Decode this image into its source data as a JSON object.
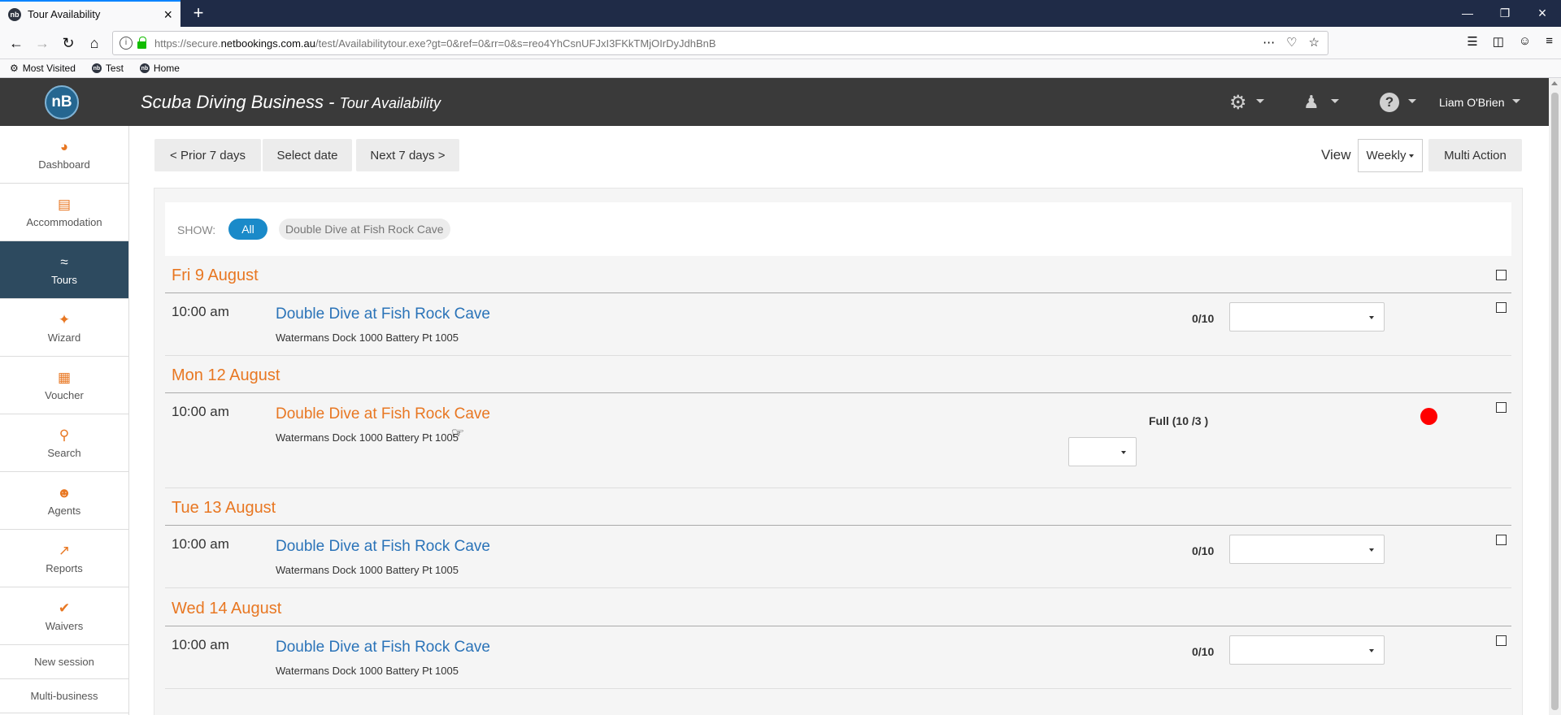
{
  "browser": {
    "tab_title": "Tour Availability",
    "tab_favicon": "nb",
    "url_prefix": "https://secure.",
    "url_host": "netbookings.com.au",
    "url_path": "/test/Availabilitytour.exe?gt=0&ref=0&rr=0&s=reo4YhCsnUFJxI3FKkTMjOIrDyJdhBnB",
    "bookmarks": [
      "Most Visited",
      "Test",
      "Home"
    ]
  },
  "app": {
    "logo_text": "nB",
    "business_name": "Scuba Diving Business",
    "separator": " - ",
    "page_name": "Tour Availability",
    "user_name": "Liam O'Brien"
  },
  "sidebar": {
    "items": [
      {
        "label": "Dashboard",
        "icon": "gauge-icon"
      },
      {
        "label": "Accommodation",
        "icon": "bed-icon"
      },
      {
        "label": "Tours",
        "icon": "swimmer-icon",
        "active": true
      },
      {
        "label": "Wizard",
        "icon": "magic-wand-icon"
      },
      {
        "label": "Voucher",
        "icon": "gift-icon"
      },
      {
        "label": "Search",
        "icon": "search-icon"
      },
      {
        "label": "Agents",
        "icon": "agent-icon"
      },
      {
        "label": "Reports",
        "icon": "chart-icon"
      },
      {
        "label": "Waivers",
        "icon": "check-icon"
      }
    ],
    "links": [
      "New session",
      "Multi-business"
    ]
  },
  "toolbar": {
    "prior": "< Prior 7 days",
    "select_date": "Select date",
    "next": "Next 7 days >",
    "view_label": "View",
    "view_value": "Weekly",
    "multi_action": "Multi Action"
  },
  "filter": {
    "show_label": "SHOW:",
    "all": "All",
    "tour": "Double Dive at Fish Rock Cave"
  },
  "days": [
    {
      "title": "Fri 9 August",
      "time": "10:00 am",
      "tour": "Double Dive at Fish Rock Cave",
      "location": "Watermans Dock 1000 Battery Pt 1005",
      "capacity": "0/10"
    },
    {
      "title": "Mon 12 August",
      "time": "10:00 am",
      "tour": "Double Dive at Fish Rock Cave",
      "location": "Watermans Dock 1000 Battery Pt 1005",
      "capacity": "Full (10 /3 )",
      "status_color": "#ff0000"
    },
    {
      "title": "Tue 13 August",
      "time": "10:00 am",
      "tour": "Double Dive at Fish Rock Cave",
      "location": "Watermans Dock 1000 Battery Pt 1005",
      "capacity": "0/10"
    },
    {
      "title": "Wed 14 August",
      "time": "10:00 am",
      "tour": "Double Dive at Fish Rock Cave",
      "location": "Watermans Dock 1000 Battery Pt 1005",
      "capacity": "0/10"
    }
  ],
  "colors": {
    "accent_orange": "#e87722",
    "link_blue": "#2a73b8",
    "pill_blue": "#1a8ac9",
    "header_dark": "#3a3a3a",
    "sidebar_active": "#2d4a5f"
  }
}
